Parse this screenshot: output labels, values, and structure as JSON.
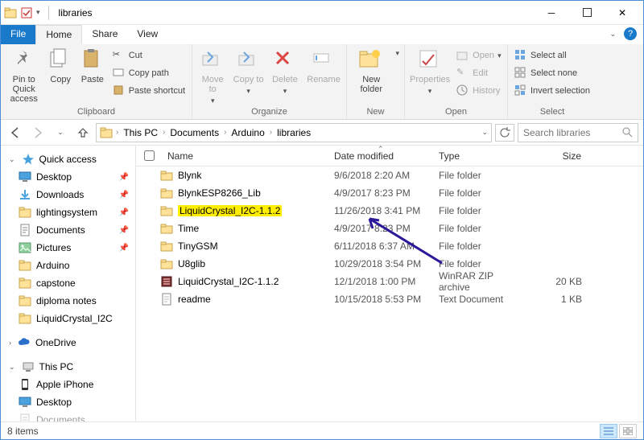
{
  "window": {
    "title": "libraries"
  },
  "tabs": {
    "file": "File",
    "home": "Home",
    "share": "Share",
    "view": "View"
  },
  "ribbon": {
    "clipboard": {
      "label": "Clipboard",
      "pin": "Pin to Quick access",
      "copy": "Copy",
      "paste": "Paste",
      "cut": "Cut",
      "copy_path": "Copy path",
      "paste_shortcut": "Paste shortcut"
    },
    "organize": {
      "label": "Organize",
      "move": "Move to",
      "copy": "Copy to",
      "delete": "Delete",
      "rename": "Rename"
    },
    "new": {
      "label": "New",
      "folder": "New folder"
    },
    "open": {
      "label": "Open",
      "properties": "Properties",
      "open": "Open",
      "edit": "Edit",
      "history": "History"
    },
    "select": {
      "label": "Select",
      "all": "Select all",
      "none": "Select none",
      "invert": "Invert selection"
    }
  },
  "breadcrumb": {
    "items": [
      "This PC",
      "Documents",
      "Arduino",
      "libraries"
    ]
  },
  "search": {
    "placeholder": "Search libraries"
  },
  "columns": {
    "name": "Name",
    "date": "Date modified",
    "type": "Type",
    "size": "Size"
  },
  "sidebar": {
    "quick": "Quick access",
    "items": [
      "Desktop",
      "Downloads",
      "lightingsystem",
      "Documents",
      "Pictures",
      "Arduino",
      "capstone",
      "diploma notes",
      "LiquidCrystal_I2C"
    ],
    "onedrive": "OneDrive",
    "thispc": "This PC",
    "pc_items": [
      "Apple iPhone",
      "Desktop",
      "Documents"
    ]
  },
  "files": [
    {
      "name": "Blynk",
      "date": "9/6/2018 2:20 AM",
      "type": "File folder",
      "size": "",
      "icon": "folder"
    },
    {
      "name": "BlynkESP8266_Lib",
      "date": "4/9/2017 8:23 PM",
      "type": "File folder",
      "size": "",
      "icon": "folder"
    },
    {
      "name": "LiquidCrystal_I2C-1.1.2",
      "date": "11/26/2018 3:41 PM",
      "type": "File folder",
      "size": "",
      "icon": "folder",
      "highlight": true
    },
    {
      "name": "Time",
      "date": "4/9/2017 8:23 PM",
      "type": "File folder",
      "size": "",
      "icon": "folder"
    },
    {
      "name": "TinyGSM",
      "date": "6/11/2018 6:37 AM",
      "type": "File folder",
      "size": "",
      "icon": "folder"
    },
    {
      "name": "U8glib",
      "date": "10/29/2018 3:54 PM",
      "type": "File folder",
      "size": "",
      "icon": "folder"
    },
    {
      "name": "LiquidCrystal_I2C-1.1.2",
      "date": "12/1/2018 1:00 PM",
      "type": "WinRAR ZIP archive",
      "size": "20 KB",
      "icon": "zip"
    },
    {
      "name": "readme",
      "date": "10/15/2018 5:53 PM",
      "type": "Text Document",
      "size": "1 KB",
      "icon": "txt"
    }
  ],
  "status": {
    "count": "8 items"
  }
}
